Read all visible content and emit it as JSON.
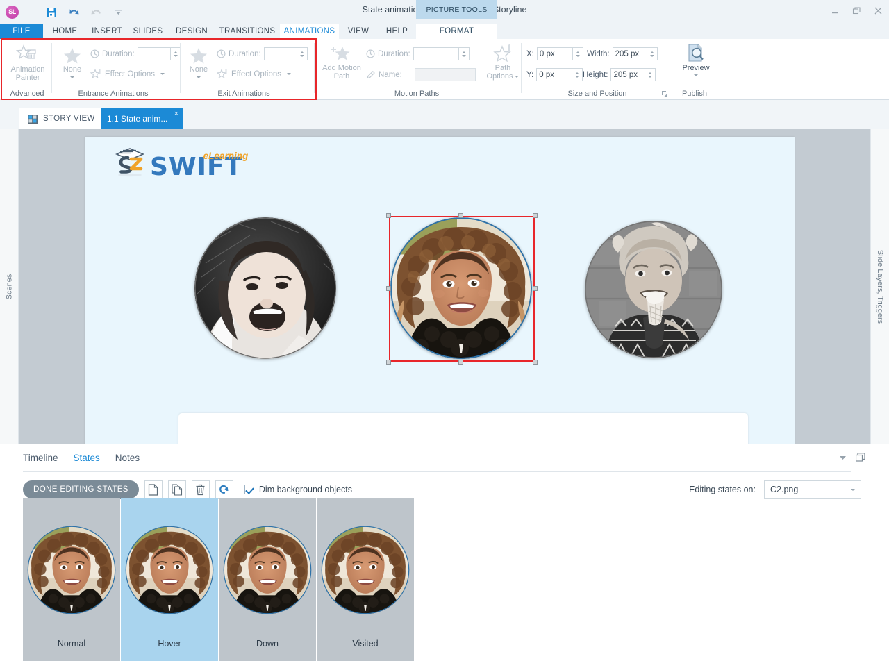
{
  "window": {
    "app_icon": "SL",
    "doc_title": "State animation.story* - Articulate Storyline",
    "quick_access": [
      {
        "name": "save-icon",
        "label": "Save"
      },
      {
        "name": "undo-icon",
        "label": "Undo"
      },
      {
        "name": "redo-icon",
        "label": "Redo"
      },
      {
        "name": "customize-qat-icon",
        "label": "Customize Quick Access Toolbar"
      }
    ],
    "contextual_tools_label": "PICTURE TOOLS",
    "controls": {
      "minimize": "minimize-icon",
      "restore": "restore-icon",
      "close": "close-icon",
      "help": "?"
    }
  },
  "ribbon_tabs": {
    "file": "FILE",
    "items": [
      "HOME",
      "INSERT",
      "SLIDES",
      "DESIGN",
      "TRANSITIONS",
      "ANIMATIONS",
      "VIEW",
      "HELP"
    ],
    "active": "ANIMATIONS",
    "format": "FORMAT"
  },
  "ribbon": {
    "advanced": {
      "label": "Advanced",
      "animation_painter": "Animation\nPainter",
      "animation_painter_line1": "Animation",
      "animation_painter_line2": "Painter"
    },
    "entrance": {
      "label": "Entrance Animations",
      "none": "None",
      "duration_label": "Duration:",
      "duration_value": "",
      "effect_options": "Effect Options"
    },
    "exit": {
      "label": "Exit Animations",
      "none": "None",
      "duration_label": "Duration:",
      "duration_value": "",
      "effect_options": "Effect Options"
    },
    "motion_paths": {
      "label": "Motion Paths",
      "add_motion_path_l1": "Add Motion",
      "add_motion_path_l2": "Path",
      "duration_label": "Duration:",
      "duration_value": "",
      "name_label": "Name:",
      "name_value": "",
      "path_options_l1": "Path",
      "path_options_l2": "Options"
    },
    "size_position": {
      "label": "Size and Position",
      "x_label": "X:",
      "x_value": "0 px",
      "y_label": "Y:",
      "y_value": "0 px",
      "width_label": "Width:",
      "width_value": "205 px",
      "height_label": "Height:",
      "height_value": "205 px"
    },
    "publish": {
      "label": "Publish",
      "preview": "Preview"
    }
  },
  "viewbar": {
    "story_view": "STORY VIEW",
    "slide_tab": "1.1 State anim...",
    "slide_tab_close": "×",
    "device_icons": [
      "laptop-preview-icon",
      "desktop-preview-icon",
      "tablet-portrait-preview-icon",
      "tablet-landscape-preview-icon",
      "phone-preview-icon",
      "player-settings-gear-icon"
    ]
  },
  "workspace": {
    "left_rail": "Scenes",
    "right_rail": "Slide Layers, Triggers",
    "slide": {
      "logo_text": "SW",
      "logo_text_2": "IFT",
      "logo_sup": "eLearning",
      "images": [
        {
          "name": "photo-girl-grass-grayscale",
          "alt": "Laughing girl lying in grass, grayscale"
        },
        {
          "name": "photo-girl-curly-color",
          "alt": "Smiling girl with curly hair, color, selected"
        },
        {
          "name": "photo-boy-icecream-grayscale",
          "alt": "Boy with ice cream cone, grayscale"
        }
      ],
      "selected_image": "photo-girl-curly-color"
    }
  },
  "panel": {
    "tabs": [
      {
        "label": "Timeline",
        "selected": false
      },
      {
        "label": "States",
        "selected": true
      },
      {
        "label": "Notes",
        "selected": false
      }
    ],
    "toolbar": {
      "done_editing": "DONE EDITING STATES",
      "new_state": "new-state-icon",
      "duplicate_state": "duplicate-state-icon",
      "delete_state": "delete-state-icon",
      "edit_state": "edit-state-icon",
      "dim_checkbox_label": "Dim background objects",
      "dim_checked": true
    },
    "editing_states_on_label": "Editing states on:",
    "editing_states_on_value": "C2.png",
    "states": [
      {
        "name": "Normal",
        "selected": false
      },
      {
        "name": "Hover",
        "selected": true
      },
      {
        "name": "Down",
        "selected": false
      },
      {
        "name": "Visited",
        "selected": false
      }
    ]
  },
  "colors": {
    "accent_blue": "#1c8ad6",
    "selection_red": "#e8262a",
    "ribbon_bg": "#ffffff",
    "chrome_bg": "#eef3f7",
    "slide_bg": "#e9f6fd",
    "state_card_bg": "#bec5cb",
    "state_card_selected_bg": "#a9d4ee",
    "workspace_bg": "#c3cbd2",
    "logo_blue": "#3479bd",
    "logo_orange": "#f0a32a"
  }
}
